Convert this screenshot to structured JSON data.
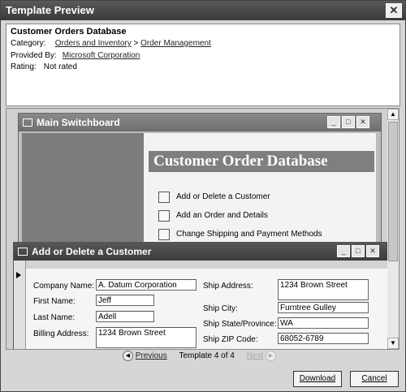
{
  "window": {
    "title": "Template Preview",
    "close_label": "✕"
  },
  "info": {
    "name": "Customer Orders Database",
    "category_label": "Category:",
    "category_1": "Orders and Inventory",
    "separator": ">",
    "category_2": "Order Management",
    "provided_label": "Provided By:",
    "provider": "Microsoft Corporation",
    "rating_label": "Rating:",
    "rating": "Not rated"
  },
  "switchboard": {
    "title": "Main Switchboard",
    "banner": "Customer Order Database",
    "items": [
      "Add or Delete a Customer",
      "Add an Order and Details",
      "Change Shipping and Payment Methods"
    ]
  },
  "customer_form": {
    "title": "Add or Delete a Customer",
    "fields": {
      "company_label": "Company Name:",
      "company": "A. Datum Corporation",
      "first_label": "First Name:",
      "first": "Jeff",
      "last_label": "Last Name:",
      "last": "Adell",
      "billing_label": "Billing Address:",
      "billing": "1234 Brown Street",
      "ship_address_label": "Ship Address:",
      "ship_address": "1234 Brown Street",
      "ship_city_label": "Ship City:",
      "ship_city": "Furntree Gulley",
      "ship_state_label": "Ship State/Province:",
      "ship_state": "WA",
      "ship_zip_label": "Ship ZIP Code:",
      "ship_zip": "68052-6789"
    }
  },
  "navigation": {
    "previous": "Previous",
    "status": "Template 4 of 4",
    "next": "Next"
  },
  "buttons": {
    "download": "Download",
    "cancel": "Cancel"
  }
}
